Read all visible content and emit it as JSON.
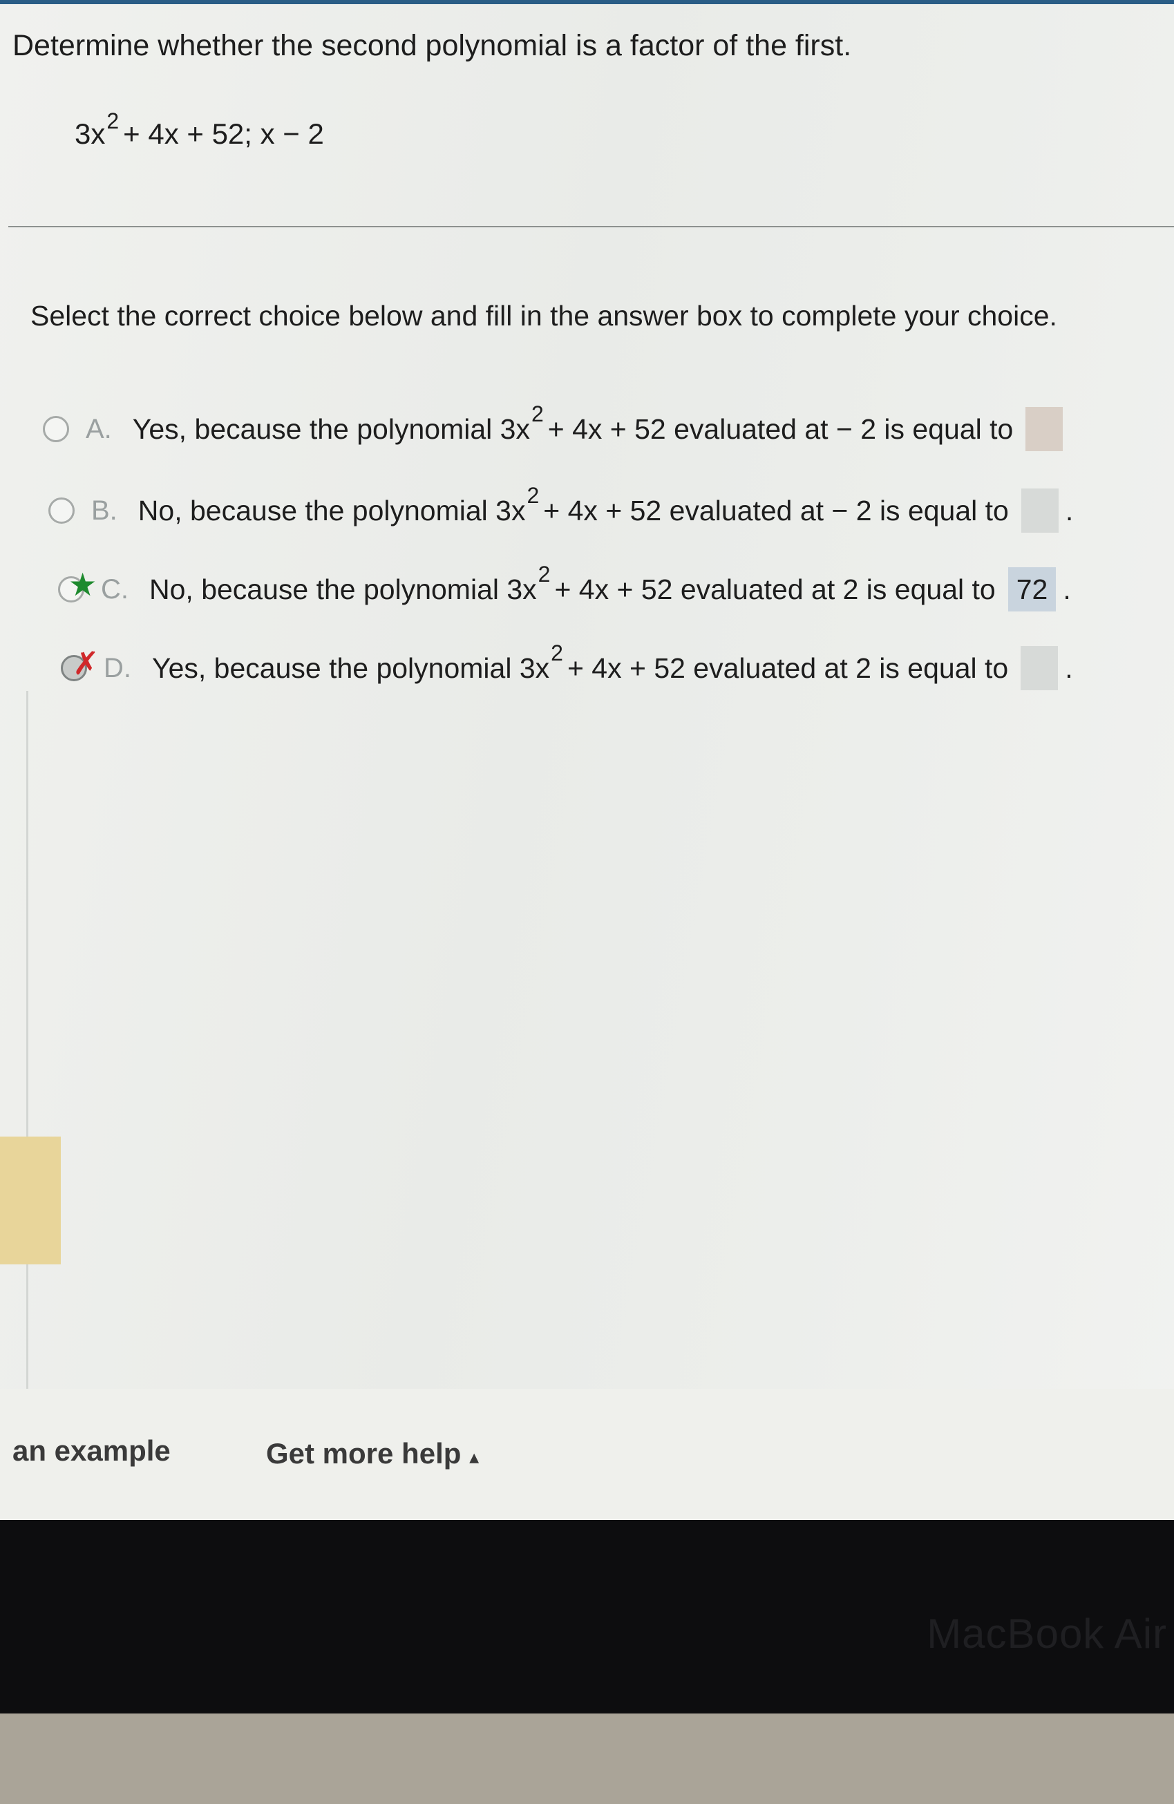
{
  "question": {
    "title": "Determine whether the second polynomial is a factor of the first.",
    "poly_lead": "3x",
    "poly_exp": "2",
    "poly_tail": "+ 4x + 52; x − 2"
  },
  "instruction": "Select the correct choice below and fill in the answer box to complete your choice.",
  "choices": [
    {
      "letter": "A.",
      "pre": "Yes, because the polynomial 3x",
      "exp": "2",
      "post": "+ 4x + 52 evaluated at  − 2 is equal to",
      "answer": "",
      "mark": ""
    },
    {
      "letter": "B.",
      "pre": "No, because the polynomial 3x",
      "exp": "2",
      "post": "+ 4x + 52 evaluated at  − 2 is equal to",
      "answer": "",
      "mark": ""
    },
    {
      "letter": "C.",
      "pre": "No, because the polynomial 3x",
      "exp": "2",
      "post": "+ 4x + 52 evaluated at 2 is equal to",
      "answer": "72",
      "mark": "correct-star"
    },
    {
      "letter": "D.",
      "pre": "Yes, because the polynomial 3x",
      "exp": "2",
      "post": "+ 4x + 52 evaluated at 2 is equal to",
      "answer": "",
      "mark": "incorrect-x"
    }
  ],
  "footer": {
    "example_label": "an example",
    "help_label": "Get more help",
    "help_arrow": "▴"
  },
  "device": {
    "label": "MacBook Air"
  },
  "marks": {
    "star": "★",
    "x": "✗",
    "period": "."
  },
  "colors": {
    "accent": "#2a5d86",
    "correct": "#1e8a2e",
    "incorrect": "#d0282a",
    "answer_box_filled": "#c9d4de"
  }
}
